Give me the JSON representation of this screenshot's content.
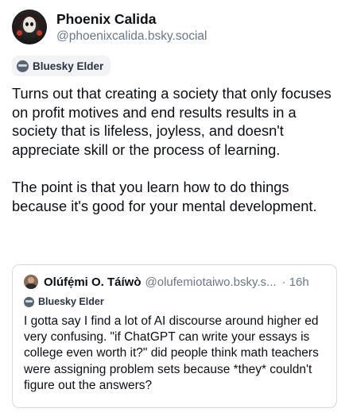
{
  "author": {
    "display_name": "Phoenix Calida",
    "handle": "@phoenixcalida.bsky.social",
    "badge": "Bluesky Elder"
  },
  "post": {
    "text": "Turns out that creating a society that only focuses on profit motives and end results results in a society that is lifeless, joyless, and doesn't appreciate skill or the process of learning.\n\nThe point is that you learn how to do things because it's good for your mental development."
  },
  "quoted_post": {
    "display_name": "Olúfẹ́mi O. Táíwò",
    "handle": "@olufemiotaiwo.bsky.s...",
    "time": "· 16h",
    "badge": "Bluesky Elder",
    "text": "I gotta say I find a lot of AI discourse around higher ed very confusing. \"if ChatGPT can write your essays is college even worth it?\" did people think math teachers were assigning problem sets because *they* couldn't figure out the answers?"
  },
  "colors": {
    "text": "#0b0f14",
    "muted": "#6b7787",
    "border": "#d4dbe2",
    "badge_bg": "#f1f3f5"
  }
}
